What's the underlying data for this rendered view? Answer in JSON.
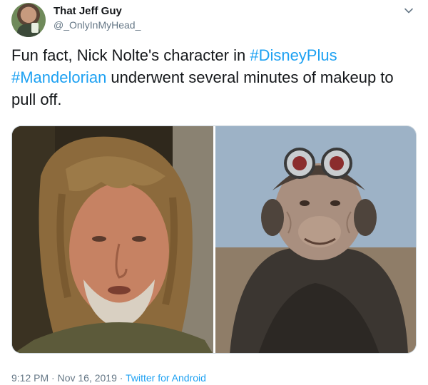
{
  "user": {
    "display_name": "That Jeff Guy",
    "handle": "@_OnlyInMyHead_"
  },
  "tweet": {
    "text_parts": [
      {
        "text": "Fun fact, Nick Nolte's character in ",
        "type": "text"
      },
      {
        "text": "#DisneyPlus",
        "type": "hashtag"
      },
      {
        "text": " ",
        "type": "text"
      },
      {
        "text": "#Mandelorian",
        "type": "hashtag"
      },
      {
        "text": " underwent several minutes of makeup to pull off.",
        "type": "text"
      }
    ]
  },
  "media": {
    "left_photo": "nick-nolte-photo",
    "right_photo": "kuiil-character-photo"
  },
  "footer": {
    "time": "9:12 PM",
    "sep1": " · ",
    "date": "Nov 16, 2019",
    "sep2": " · ",
    "source": "Twitter for Android"
  },
  "colors": {
    "hashtag": "#1da1f2",
    "secondary_text": "#657786",
    "primary_text": "#14171a"
  },
  "icons": {
    "menu": "chevron-down-icon"
  }
}
